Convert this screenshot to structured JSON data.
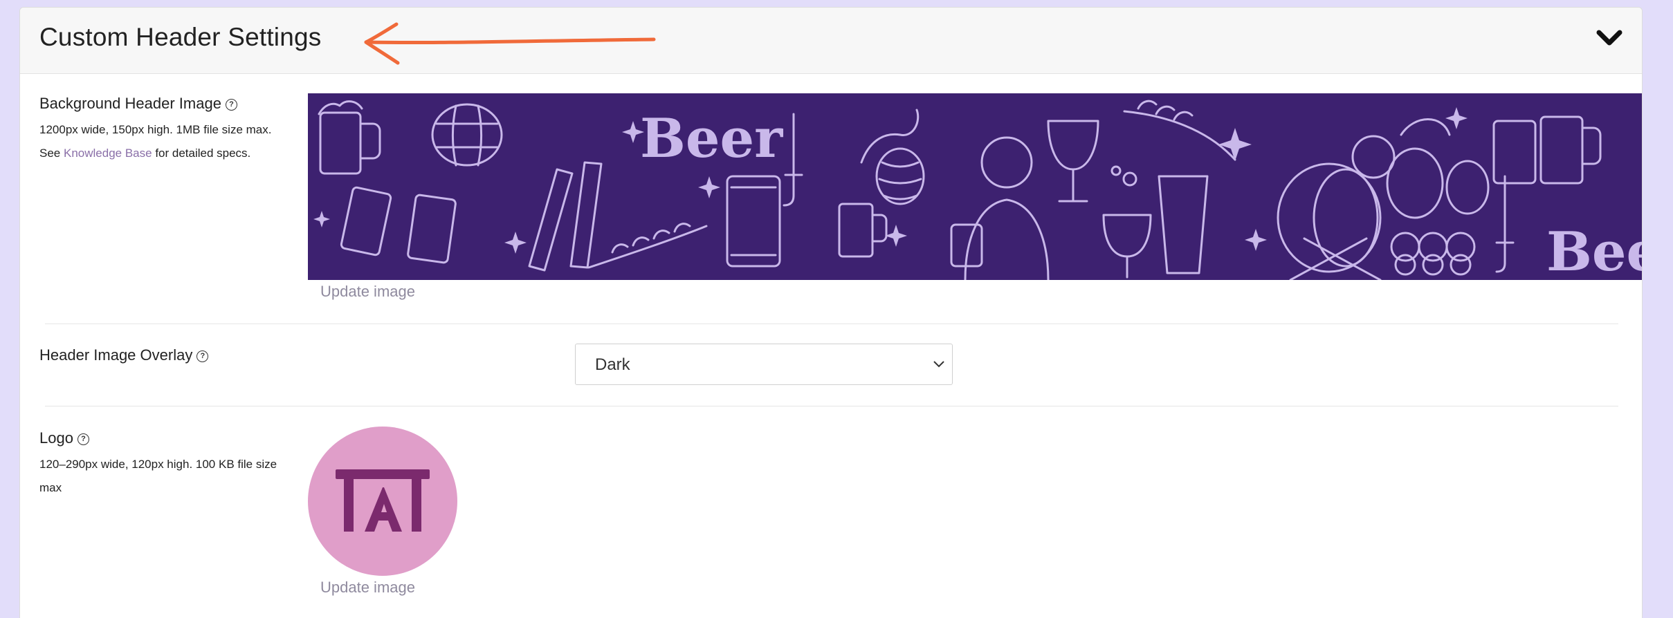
{
  "panel": {
    "title": "Custom Header Settings",
    "collapse_icon": "chevron-down-icon"
  },
  "background_header": {
    "label": "Background Header Image",
    "help_icon": "question-circle-icon",
    "spec_line": "1200px wide, 150px high. 1MB file size max.",
    "see_prefix": "See",
    "link_text": "Knowledge Base",
    "see_suffix": "for detailed specs.",
    "banner_text": "Beer",
    "banner_text_2": "Beer",
    "update_label": "Update image"
  },
  "overlay": {
    "label": "Header Image Overlay",
    "help_icon": "question-circle-icon",
    "selected": "Dark"
  },
  "logo": {
    "label": "Logo",
    "help_icon": "question-circle-icon",
    "spec_line": "120–290px wide, 120px high. 100 KB file size max",
    "update_label": "Update image"
  },
  "colors": {
    "banner_bg": "#3d2170",
    "banner_art": "#c9b8ea",
    "logo_bg": "#e09ec9",
    "logo_mark": "#7b2a6d",
    "annotation": "#f06a3a",
    "link": "#8a6fa8"
  }
}
